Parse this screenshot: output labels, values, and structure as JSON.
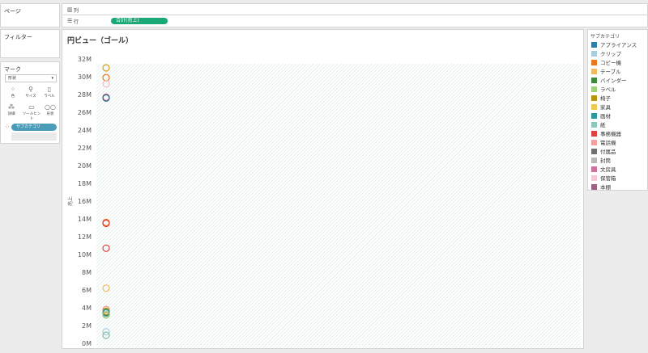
{
  "left_panel": {
    "pages_title": "ページ",
    "filters_title": "フィルター",
    "marks_title": "マーク",
    "mark_type": "形状",
    "mark_buttons": [
      {
        "label": "色",
        "icon": "color-icon"
      },
      {
        "label": "サイズ",
        "icon": "size-icon"
      },
      {
        "label": "ラベル",
        "icon": "label-icon"
      },
      {
        "label": "詳細",
        "icon": "detail-icon"
      },
      {
        "label": "ツールヒント",
        "icon": "tooltip-icon"
      },
      {
        "label": "形状",
        "icon": "shape-icon"
      }
    ],
    "field_pill": "サブカテゴリ"
  },
  "shelves": {
    "columns_label": "列",
    "rows_label": "行",
    "rows_pill": "合計(売上)"
  },
  "chart_data": {
    "type": "scatter",
    "title": "円ビュー（ゴール）",
    "ylabel": "売上",
    "ylim": [
      0,
      32000000
    ],
    "yticks": [
      "0M",
      "2M",
      "4M",
      "6M",
      "8M",
      "10M",
      "12M",
      "14M",
      "16M",
      "18M",
      "20M",
      "22M",
      "24M",
      "26M",
      "28M",
      "30M",
      "32M"
    ],
    "points": [
      {
        "y": 31000000,
        "color": "#d4a017"
      },
      {
        "y": 29900000,
        "color": "#e87722"
      },
      {
        "y": 29200000,
        "color": "#f2b8c0"
      },
      {
        "y": 27700000,
        "color": "#c96b8a"
      },
      {
        "y": 27600000,
        "color": "#2b6c8c"
      },
      {
        "y": 13600000,
        "color": "#e87722"
      },
      {
        "y": 13500000,
        "color": "#e04040"
      },
      {
        "y": 10700000,
        "color": "#e04040"
      },
      {
        "y": 6200000,
        "color": "#f5b85a"
      },
      {
        "y": 3800000,
        "color": "#f28b82"
      },
      {
        "y": 3600000,
        "color": "#d4a017"
      },
      {
        "y": 3500000,
        "color": "#2e8b57"
      },
      {
        "y": 3400000,
        "color": "#4aa3a3"
      },
      {
        "y": 3200000,
        "color": "#8fbf5a"
      },
      {
        "y": 1300000,
        "color": "#a8c9e0"
      },
      {
        "y": 900000,
        "color": "#7fbf9f"
      }
    ]
  },
  "legend": {
    "title": "サブカテゴリ",
    "items": [
      {
        "label": "アプライアンス",
        "color": "#2e7fa8"
      },
      {
        "label": "クリップ",
        "color": "#a8cde0"
      },
      {
        "label": "コピー機",
        "color": "#e87722"
      },
      {
        "label": "テーブル",
        "color": "#f5b85a"
      },
      {
        "label": "バインダー",
        "color": "#3a8a3a"
      },
      {
        "label": "ラベル",
        "color": "#9fd07a"
      },
      {
        "label": "椅子",
        "color": "#b8960c"
      },
      {
        "label": "家具",
        "color": "#f0c850"
      },
      {
        "label": "画材",
        "color": "#2a9a9a"
      },
      {
        "label": "紙",
        "color": "#8cc8c0"
      },
      {
        "label": "事務機器",
        "color": "#e04040"
      },
      {
        "label": "電話機",
        "color": "#f4a0a0"
      },
      {
        "label": "付属品",
        "color": "#707070"
      },
      {
        "label": "封筒",
        "color": "#b8b8b8"
      },
      {
        "label": "文房具",
        "color": "#d070a0"
      },
      {
        "label": "保管箱",
        "color": "#f4c8d8"
      },
      {
        "label": "本棚",
        "color": "#a06080"
      }
    ]
  }
}
